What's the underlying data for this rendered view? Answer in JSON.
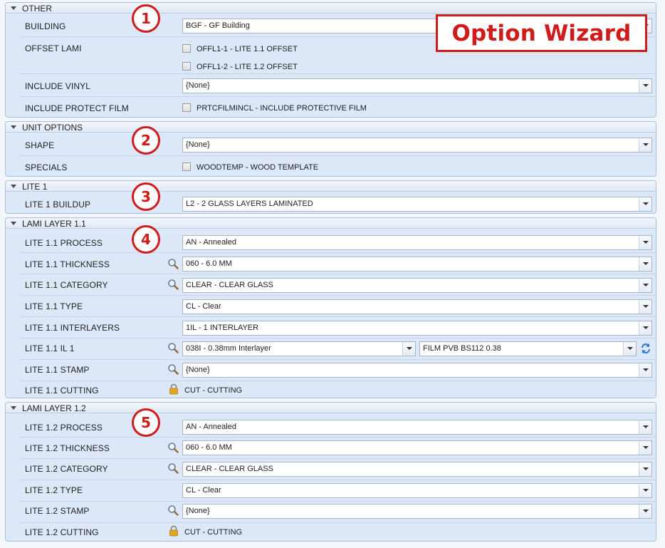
{
  "overlay": {
    "title": "Option Wizard",
    "badges": [
      "1",
      "2",
      "3",
      "4",
      "5"
    ]
  },
  "sections": {
    "other": {
      "title": "OTHER",
      "building_label": "BUILDING",
      "building_value": "BGF - GF Building",
      "offset_lami_label": "OFFSET LAMI",
      "offset_option_1": "OFFL1-1 - LITE 1.1 OFFSET",
      "offset_option_2": "OFFL1-2 - LITE 1.2 OFFSET",
      "include_vinyl_label": "INCLUDE VINYL",
      "include_vinyl_value": "{None}",
      "include_protect_label": "INCLUDE PROTECT FILM",
      "include_protect_option": "PRTCFILMINCL - INCLUDE PROTECTIVE FILM"
    },
    "unit_options": {
      "title": "UNIT OPTIONS",
      "shape_label": "SHAPE",
      "shape_value": "{None}",
      "specials_label": "SPECIALS",
      "specials_option": "WOODTEMP - WOOD TEMPLATE"
    },
    "lite1": {
      "title": "LITE 1",
      "buildup_label": "LITE 1 BUILDUP",
      "buildup_value": "L2 - 2 GLASS LAYERS LAMINATED"
    },
    "lami11": {
      "title": "LAMI LAYER 1.1",
      "process_label": "LITE 1.1 PROCESS",
      "process_value": "AN - Annealed",
      "thickness_label": "LITE 1.1 THICKNESS",
      "thickness_value": "060 - 6.0 MM",
      "category_label": "LITE 1.1 CATEGORY",
      "category_value": "CLEAR - CLEAR GLASS",
      "type_label": "LITE 1.1 TYPE",
      "type_value": "CL - Clear",
      "interlayers_label": "LITE 1.1 INTERLAYERS",
      "interlayers_value": "1IL - 1 INTERLAYER",
      "il1_label": "LITE 1.1 IL 1",
      "il1_value": "038I - 0.38mm Interlayer",
      "il1_film_value": "FILM PVB BS112 0.38",
      "stamp_label": "LITE 1.1 STAMP",
      "stamp_value": "{None}",
      "cutting_label": "LITE 1.1 CUTTING",
      "cutting_value": "CUT - CUTTING"
    },
    "lami12": {
      "title": "LAMI LAYER 1.2",
      "process_label": "LITE 1.2 PROCESS",
      "process_value": "AN - Annealed",
      "thickness_label": "LITE 1.2 THICKNESS",
      "thickness_value": "060 - 6.0 MM",
      "category_label": "LITE 1.2 CATEGORY",
      "category_value": "CLEAR - CLEAR GLASS",
      "type_label": "LITE 1.2 TYPE",
      "type_value": "CL - Clear",
      "stamp_label": "LITE 1.2 STAMP",
      "stamp_value": "{None}",
      "cutting_label": "LITE 1.2 CUTTING",
      "cutting_value": "CUT - CUTTING"
    }
  },
  "colors": {
    "annotation_red": "#d01b1b",
    "panel_bg": "#dce8f7",
    "panel_border": "#a9c0dd"
  }
}
